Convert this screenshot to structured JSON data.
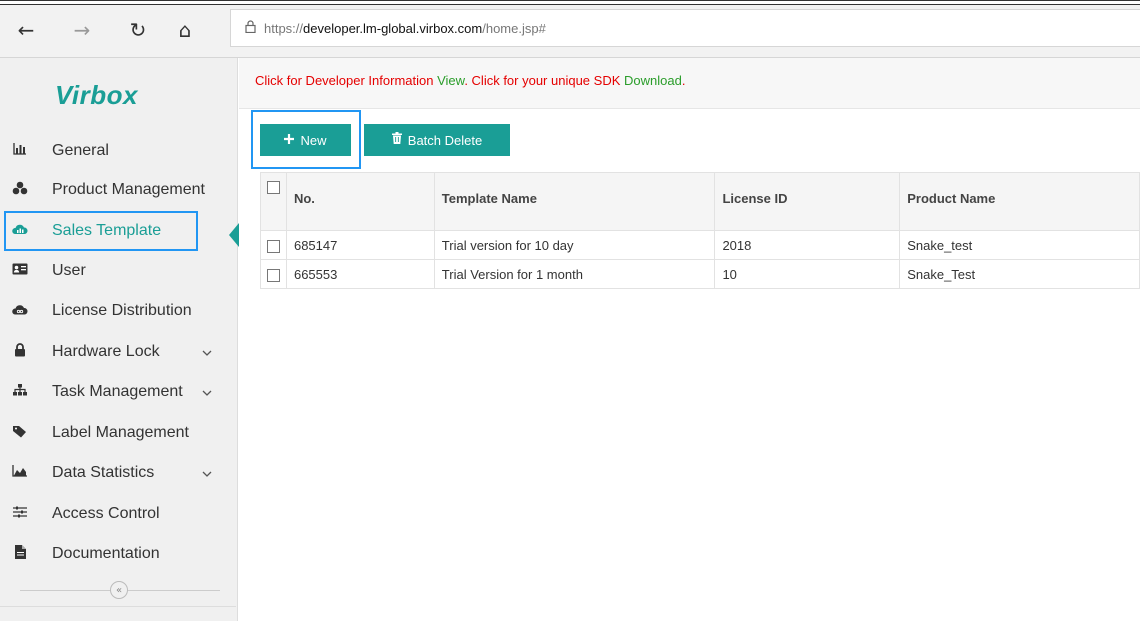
{
  "browser": {
    "back_icon": "←",
    "forward_icon": "→",
    "refresh_icon": "↻",
    "home_icon": "⌂",
    "lock_icon": "🔒",
    "url_prefix": "https://",
    "url_host": "developer.lm-global.virbox.com",
    "url_path": "/home.jsp#"
  },
  "sidebar": {
    "logo": "Virbox",
    "items": [
      {
        "label": "General",
        "icon": "bar-chart"
      },
      {
        "label": "Product Management",
        "icon": "cubes"
      },
      {
        "label": "Sales Template",
        "icon": "cloud-chart",
        "active": true
      },
      {
        "label": "User",
        "icon": "id-card"
      },
      {
        "label": "License Distribution",
        "icon": "cloud"
      },
      {
        "label": "Hardware Lock",
        "icon": "lock",
        "expandable": true
      },
      {
        "label": "Task Management",
        "icon": "sitemap",
        "expandable": true
      },
      {
        "label": "Label Management",
        "icon": "tags"
      },
      {
        "label": "Data Statistics",
        "icon": "area-chart",
        "expandable": true
      },
      {
        "label": "Access Control",
        "icon": "sliders"
      },
      {
        "label": "Documentation",
        "icon": "file"
      }
    ],
    "collapse_icon": "«"
  },
  "notice": {
    "part1": "Click for Developer Information ",
    "link1": "View",
    "part2": ".  Click for your unique SDK ",
    "link2": "Download",
    "part3": "."
  },
  "toolbar": {
    "new_label": "New",
    "new_icon": "+",
    "delete_label": "Batch Delete",
    "delete_icon": "🗑"
  },
  "table": {
    "columns": [
      "No.",
      "Template Name",
      "License ID",
      "Product Name"
    ],
    "rows": [
      [
        "685147",
        "Trial version for 10 day",
        "2018",
        "Snake_test"
      ],
      [
        "665553",
        "Trial Version for 1 month",
        "10",
        "Snake_Test"
      ]
    ]
  },
  "colors": {
    "accent": "#1a9e96",
    "highlight": "#2196f3",
    "notice_red": "#e50000",
    "notice_green": "#2a9d2a"
  }
}
